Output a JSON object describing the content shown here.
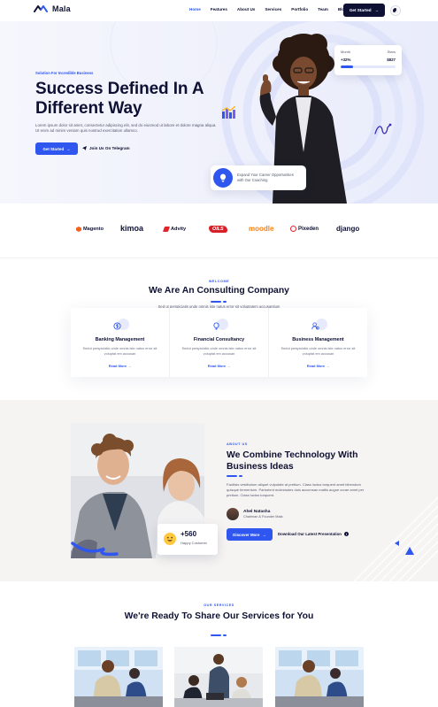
{
  "header": {
    "logo_text": "Mala",
    "nav": [
      "Home",
      "Features",
      "About Us",
      "Services",
      "Portfolio",
      "Team",
      "Blog"
    ],
    "active_nav": "Home",
    "cta_label": "Get Started",
    "cta_arrow": "→",
    "theme_toggle_icon": "moon-icon"
  },
  "hero": {
    "eyebrow": "Solution For Incredible Business",
    "title": "Success Defined In A Different Way",
    "text": "Lorem ipsum dolor sit amet, consectetur adipiscing elit, sed do eiusmod ut labore et dolore magna aliqua. Ut enim ad minim veniam quis nostrud exercitation ullamco.",
    "primary_button": "Get Started",
    "primary_arrow": "→",
    "secondary_link": "Join Us On Telegram",
    "stats_card": {
      "label_left": "Month",
      "label_right": "Stars",
      "value_left": "+32%",
      "value_right": "$827",
      "progress": 0.22
    },
    "explore_card": {
      "icon": "lightbulb-icon",
      "text_line1": "Expand Your Career Opportunities",
      "text_line2": "with Our Coaching"
    }
  },
  "brands": [
    "Magento",
    "kimoa",
    "Advity",
    "OILS",
    "moodle",
    "Pixeden",
    "django"
  ],
  "consulting": {
    "eyebrow": "WELCOME",
    "title": "We Are An Consulting Company",
    "subtitle": "Sed ut perspiciatis unde omnis iste natus error sit voluptatem accusantium",
    "cards": [
      {
        "icon": "dollar-coin-icon",
        "title": "Banking Management",
        "text": "Sedut perspiciatis unde omnis iste natus error sit voluptat em accusan",
        "link": "Read More"
      },
      {
        "icon": "lightbulb-icon",
        "title": "Financial Consultancy",
        "text": "Sedut perspiciatis unde omnis iste natus error sit voluptat em accusan",
        "link": "Read More"
      },
      {
        "icon": "user-group-icon",
        "title": "Business Management",
        "text": "Sedut perspiciatis unde omnis iste natus error sit voluptat em accusan",
        "link": "Read More"
      }
    ],
    "link_arrow": "→"
  },
  "about": {
    "eyebrow": "ABOUT US",
    "title": "We Combine Technology With Business Ideas",
    "text": "Facilisis vestibulum aliquet vulputate at pretium. Class luctus torquent amet bibendum quisque fermentum. Parturient molestudes duis accumsan mattis augue curae amet per pretium. Class luctus torquent.",
    "counter_value": "+560",
    "counter_label": "Happy Customer",
    "counter_icon": "smiley-face-icon",
    "author_name": "Ahel Natasha",
    "author_role": "Chairman & Founder Mala",
    "button_label": "Discover More",
    "button_arrow": "→",
    "presentation_link": "Download Our Latest Presentation",
    "presentation_icon_glyph": "i"
  },
  "services": {
    "eyebrow": "OUR SERVICES",
    "title": "We're Ready To Share Our Services for You"
  },
  "colors": {
    "accent": "#2f57ef",
    "dark": "#0e1133",
    "about_bg": "#f6f4f2"
  }
}
